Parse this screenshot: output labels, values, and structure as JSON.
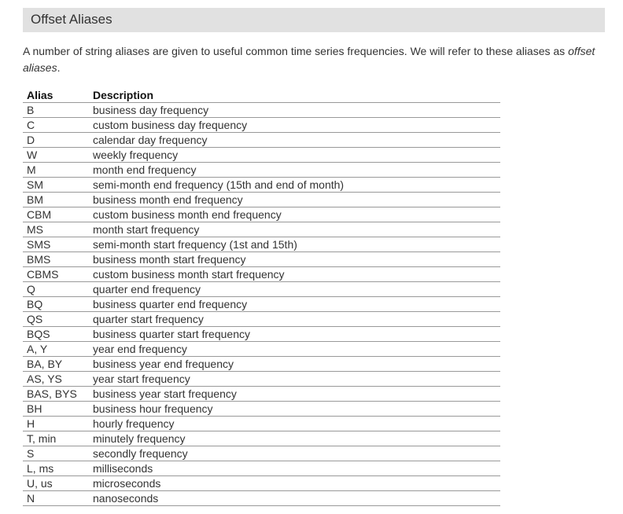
{
  "section": {
    "title": "Offset Aliases"
  },
  "intro": {
    "text": "A number of string aliases are given to useful common time series frequencies. We will refer to these aliases as",
    "emphasis": "offset aliases",
    "end": "."
  },
  "table": {
    "headers": [
      "Alias",
      "Description"
    ],
    "rows": [
      [
        "B",
        "business day frequency"
      ],
      [
        "C",
        "custom business day frequency"
      ],
      [
        "D",
        "calendar day frequency"
      ],
      [
        "W",
        "weekly frequency"
      ],
      [
        "M",
        "month end frequency"
      ],
      [
        "SM",
        "semi-month end frequency (15th and end of month)"
      ],
      [
        "BM",
        "business month end frequency"
      ],
      [
        "CBM",
        "custom business month end frequency"
      ],
      [
        "MS",
        "month start frequency"
      ],
      [
        "SMS",
        "semi-month start frequency (1st and 15th)"
      ],
      [
        "BMS",
        "business month start frequency"
      ],
      [
        "CBMS",
        "custom business month start frequency"
      ],
      [
        "Q",
        "quarter end frequency"
      ],
      [
        "BQ",
        "business quarter end frequency"
      ],
      [
        "QS",
        "quarter start frequency"
      ],
      [
        "BQS",
        "business quarter start frequency"
      ],
      [
        "A, Y",
        "year end frequency"
      ],
      [
        "BA, BY",
        "business year end frequency"
      ],
      [
        "AS, YS",
        "year start frequency"
      ],
      [
        "BAS, BYS",
        "business year start frequency"
      ],
      [
        "BH",
        "business hour frequency"
      ],
      [
        "H",
        "hourly frequency"
      ],
      [
        "T, min",
        "minutely frequency"
      ],
      [
        "S",
        "secondly frequency"
      ],
      [
        "L, ms",
        "milliseconds"
      ],
      [
        "U, us",
        "microseconds"
      ],
      [
        "N",
        "nanoseconds"
      ]
    ]
  }
}
